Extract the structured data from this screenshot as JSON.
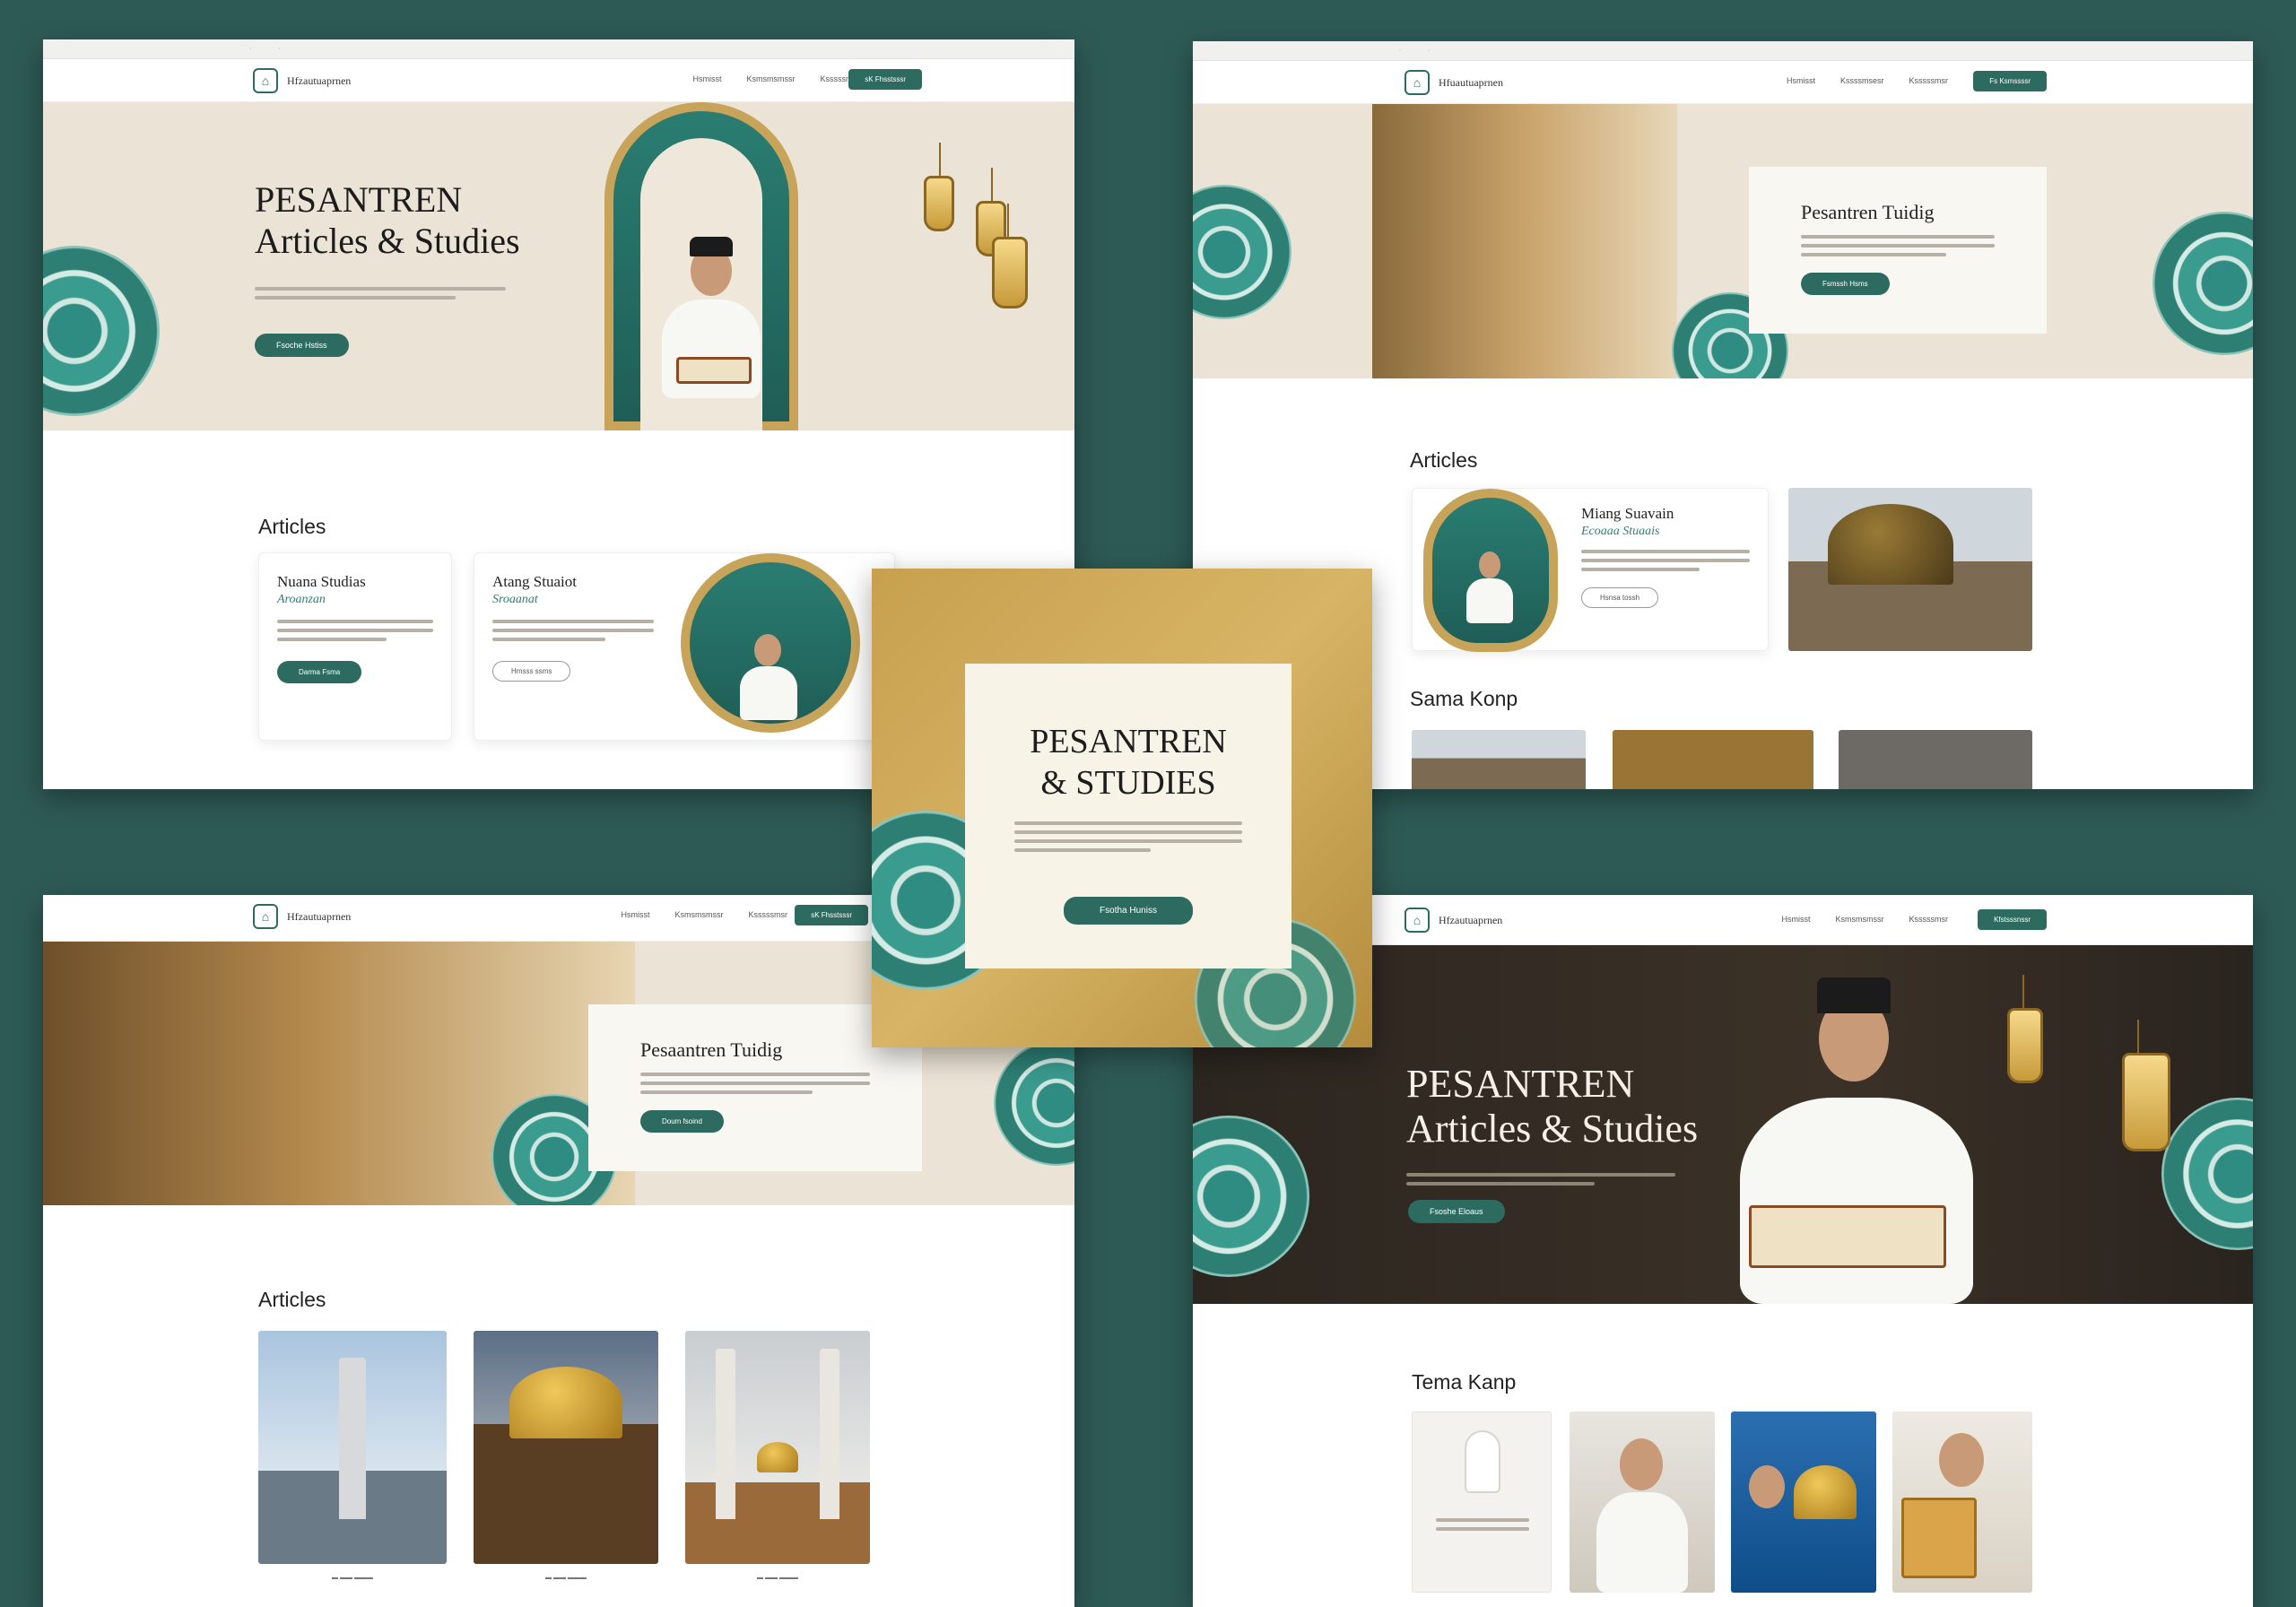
{
  "colors": {
    "background": "#2e5a55",
    "accent": "#2d6b60",
    "gold": "#c7a45a",
    "cream": "#ebe4d6"
  },
  "icons": [
    "mosque-logo-icon",
    "lantern-icon",
    "rosette-ornament-icon"
  ],
  "panel1": {
    "logo_text": "Hfzautuaprnen",
    "nav": [
      "Hsmisst",
      "Ksmsmsmssr",
      "Ksssssmsr"
    ],
    "nav_cta": "sK Fhsstsssr",
    "hero_title_1": "PESANTREN",
    "hero_title_2": "Articles & Studies",
    "hero_button": "Fsoche Hstiss",
    "section_title": "Articles",
    "cards": [
      {
        "title": "Nuana Studias",
        "subtitle": "Aroanzan",
        "button": "Darma Fsma"
      },
      {
        "title": "Atang Stuaiot",
        "subtitle": "Sroaanat",
        "button": "Hmsss ssms"
      }
    ]
  },
  "panel2": {
    "logo_text": "Hfuautuaprnen",
    "nav": [
      "Hsmisst",
      "Kssssmsesr",
      "Ksssssmsr"
    ],
    "nav_cta": "Fs Ksmssssr",
    "feature_title": "Pesantren Tuidig",
    "feature_button": "Fsmssh Hsms",
    "section_title": "Articles",
    "card": {
      "title": "Miang Suavain",
      "subtitle": "Ecoaaa Stuaais",
      "button": "Hsnsa tossh"
    },
    "section_title_2": "Sama Konp"
  },
  "panel3": {
    "logo_text": "Hfzautuaprnen",
    "nav": [
      "Hsmisst",
      "Ksmsmsmssr",
      "Ksssssmsr"
    ],
    "nav_cta": "sK Fhsstsssr",
    "feature_title": "Pesaantren Tuidig",
    "feature_button": "Doum fsoind",
    "section_title": "Articles"
  },
  "panel4": {
    "logo_text": "Hfzautuaprnen",
    "nav": [
      "Hsmisst",
      "Ksmsmsmssr",
      "Ksssssmsr"
    ],
    "nav_cta": "Kfstsssnssr",
    "hero_title_1": "PESANTREN",
    "hero_title_2": "Articles & Studies",
    "hero_button": "Fsoshe Eloaus",
    "section_title": "Tema Kanp"
  },
  "center": {
    "title_1": "PESANTREN",
    "title_2": "& STUDIES",
    "button": "Fsotha Huniss"
  }
}
